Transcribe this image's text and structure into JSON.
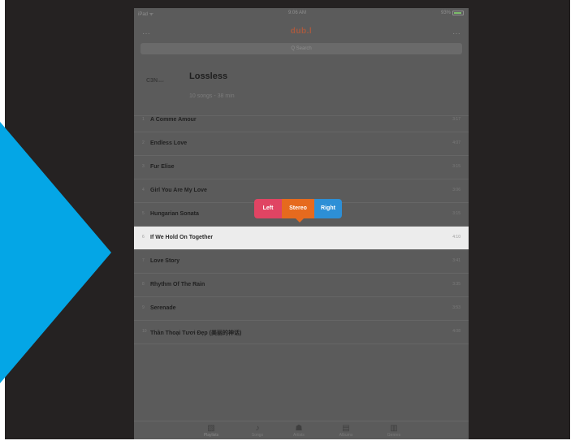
{
  "status_bar": {
    "carrier": "iPad ᯤ",
    "time": "9:06 AM",
    "battery": "93%"
  },
  "nav": {
    "logo": "dub.l",
    "menu_icon": "menu-dots-icon",
    "more_icon": "more-dots-icon"
  },
  "search": {
    "placeholder": "Q Search"
  },
  "playlist": {
    "art_label": "C3N",
    "art_sub": "music",
    "title": "Lossless",
    "subtitle": "10 songs - 38 min"
  },
  "tracks": [
    {
      "num": "1",
      "title": "A Comme Amour",
      "duration": "3:17"
    },
    {
      "num": "2",
      "title": "Endless Love",
      "duration": "4:07"
    },
    {
      "num": "3",
      "title": "Fur Elise",
      "duration": "3:15"
    },
    {
      "num": "4",
      "title": "Girl You Are My Love",
      "duration": "3:06"
    },
    {
      "num": "5",
      "title": "Hungarian Sonata",
      "duration": "3:15"
    },
    {
      "num": "6",
      "title": "If We Hold On Together",
      "duration": "4:10"
    },
    {
      "num": "7",
      "title": "Love Story",
      "duration": "3:41"
    },
    {
      "num": "8",
      "title": "Rhythm Of The Rain",
      "duration": "3:35"
    },
    {
      "num": "9",
      "title": "Serenade",
      "duration": "3:53"
    },
    {
      "num": "10",
      "title": "Thần Thoại Tươi Đẹp (美丽的神话)",
      "duration": "4:08"
    }
  ],
  "selected_track_index": 5,
  "channel_popup": {
    "left": "Left",
    "stereo": "Stereo",
    "right": "Right"
  },
  "tabs": [
    {
      "label": "Playlists",
      "icon": "playlist-icon"
    },
    {
      "label": "Songs",
      "icon": "music-note-icon"
    },
    {
      "label": "Artists",
      "icon": "artist-icon"
    },
    {
      "label": "Albums",
      "icon": "album-icon"
    },
    {
      "label": "Genres",
      "icon": "genre-icon"
    }
  ],
  "colors": {
    "chevron": "#04a6e6",
    "popup_left": "#e04463",
    "popup_stereo": "#e66a1e",
    "popup_right": "#2d8fd6"
  }
}
